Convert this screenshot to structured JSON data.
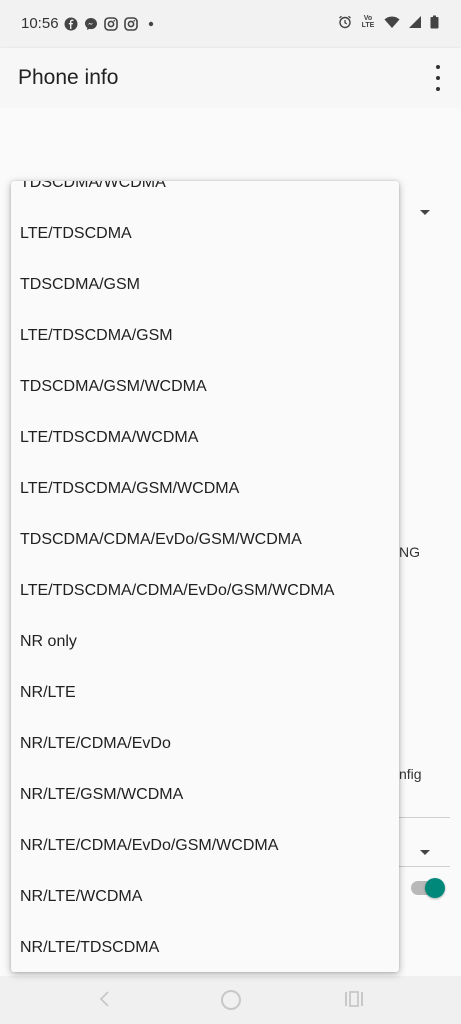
{
  "status_bar": {
    "time": "10:56",
    "left_icons": [
      "facebook-icon",
      "messenger-icon",
      "instagram-icon",
      "instagram-icon",
      "dot-icon"
    ],
    "right_icons": [
      "alarm-icon",
      "volte-icon",
      "wifi-icon",
      "signal-icon",
      "battery-icon"
    ],
    "volte_label_top": "Vo",
    "volte_label_bottom": "LTE"
  },
  "app_bar": {
    "title": "Phone info"
  },
  "background": {
    "partial_text_1": "NG",
    "partial_text_2": "nfig"
  },
  "dropdown": {
    "items": [
      "TDSCDMA/WCDMA",
      "LTE/TDSCDMA",
      "TDSCDMA/GSM",
      "LTE/TDSCDMA/GSM",
      "TDSCDMA/GSM/WCDMA",
      "LTE/TDSCDMA/WCDMA",
      "LTE/TDSCDMA/GSM/WCDMA",
      "TDSCDMA/CDMA/EvDo/GSM/WCDMA",
      "LTE/TDSCDMA/CDMA/EvDo/GSM/WCDMA",
      "NR only",
      "NR/LTE",
      "NR/LTE/CDMA/EvDo",
      "NR/LTE/GSM/WCDMA",
      "NR/LTE/CDMA/EvDo/GSM/WCDMA",
      "NR/LTE/WCDMA",
      "NR/LTE/TDSCDMA"
    ]
  },
  "colors": {
    "accent": "#00897b"
  }
}
